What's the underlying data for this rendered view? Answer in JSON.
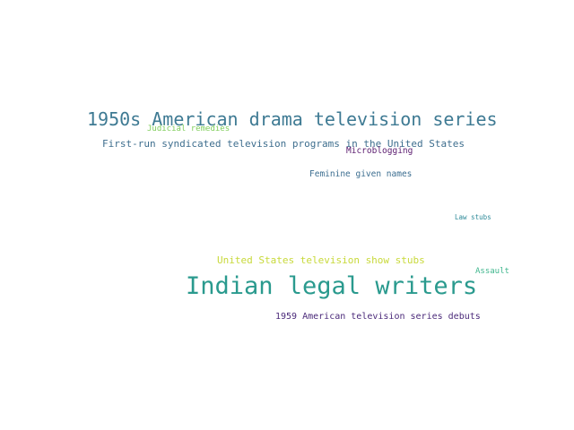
{
  "words": [
    {
      "text": "1950s American drama television series",
      "color": "#3e7a93"
    },
    {
      "text": "First-run syndicated television programs in the United States",
      "color": "#3e6e8e"
    },
    {
      "text": "Judicial remedies",
      "color": "#7fcd5a"
    },
    {
      "text": "Microblogging",
      "color": "#5a1a6e"
    },
    {
      "text": "Feminine given names",
      "color": "#3c6e90"
    },
    {
      "text": "Law stubs",
      "color": "#2e8a99"
    },
    {
      "text": "United States television show stubs",
      "color": "#c8d93a"
    },
    {
      "text": "Assault",
      "color": "#3fb68d"
    },
    {
      "text": "Indian legal writers",
      "color": "#2a9a8e"
    },
    {
      "text": "1959 American television series debuts",
      "color": "#4b2a7a"
    }
  ]
}
